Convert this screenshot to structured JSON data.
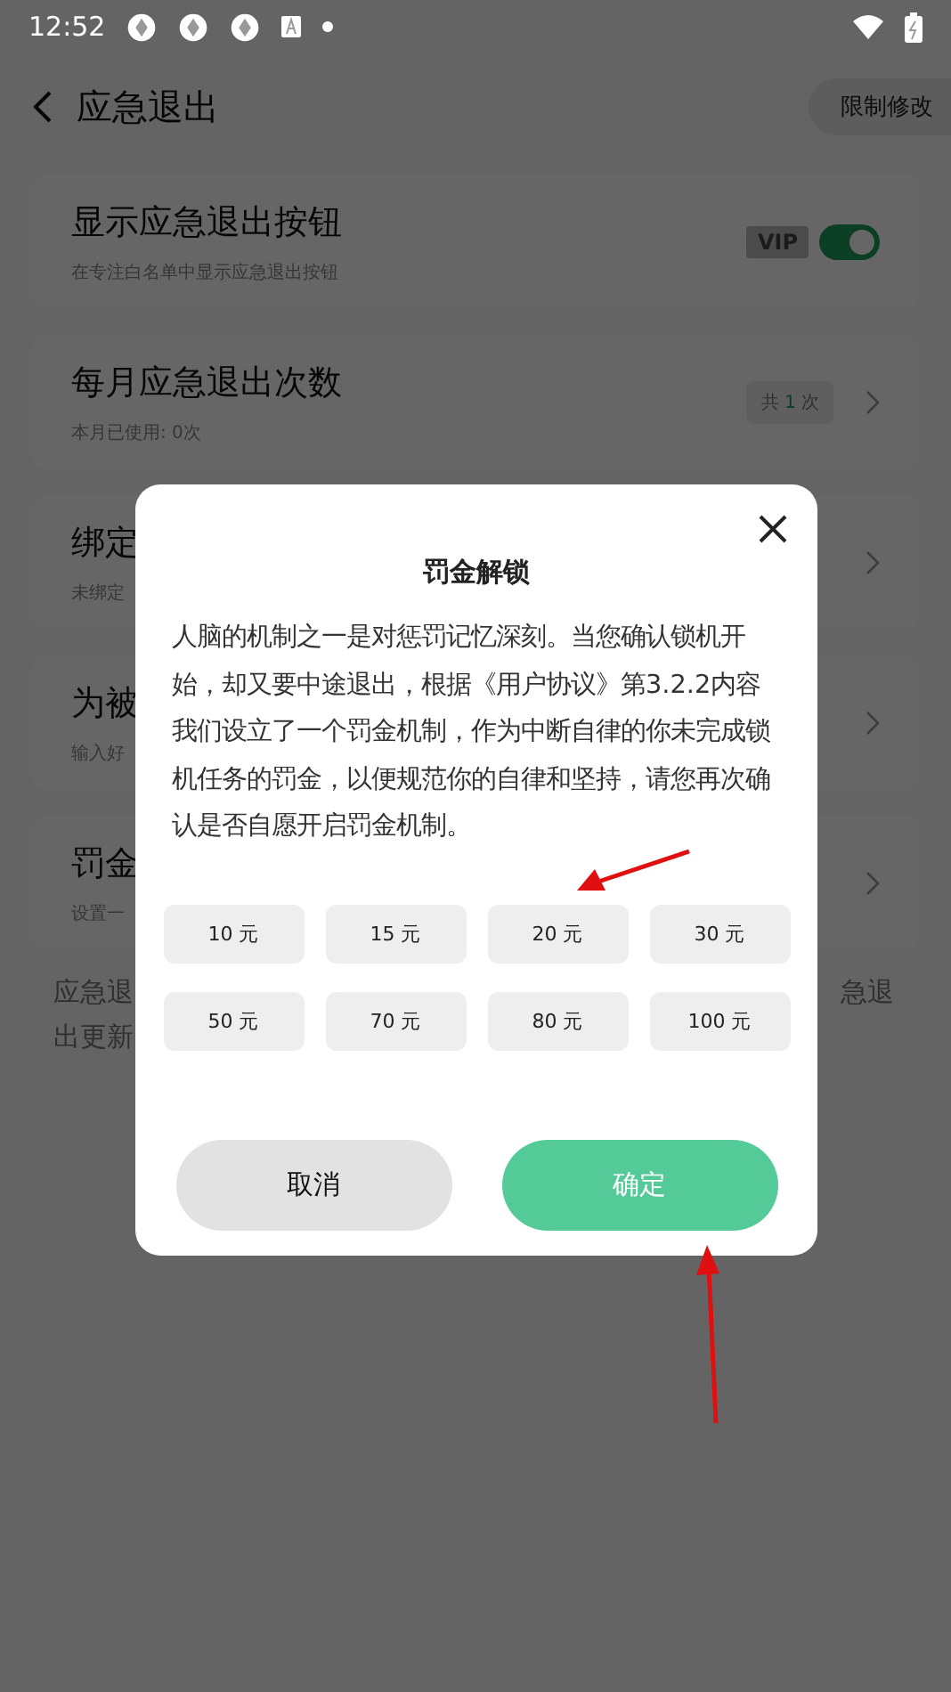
{
  "status_bar": {
    "time": "12:52"
  },
  "header": {
    "title": "应急退出",
    "action": "限制修改"
  },
  "settings": [
    {
      "kind": "toggle",
      "title": "显示应急退出按钮",
      "subtitle": "在专注白名单中显示应急退出按钮",
      "badge": "VIP",
      "on": true
    },
    {
      "kind": "count",
      "title": "每月应急退出次数",
      "subtitle": "本月已使用: 0次",
      "count_prefix": "共",
      "count": "1",
      "count_suffix": "次"
    },
    {
      "kind": "link",
      "title": "绑定",
      "subtitle": "未绑定"
    },
    {
      "kind": "link",
      "title": "为被",
      "subtitle": "输入好"
    },
    {
      "kind": "link",
      "title": "罚金",
      "subtitle": "设置一"
    }
  ],
  "footer": {
    "left_lines": [
      "应急退",
      "出更新"
    ],
    "right_fragment": "急退"
  },
  "dialog": {
    "title": "罚金解锁",
    "body": "人脑的机制之一是对惩罚记忆深刻。当您确认锁机开始，却又要中途退出，根据《用户协议》第3.2.2内容我们设立了一个罚金机制，作为中断自律的你未完成锁机任务的罚金，以便规范你的自律和坚持，请您再次确认是否自愿开启罚金机制。",
    "amounts": [
      {
        "label": "10 元",
        "selected": false
      },
      {
        "label": "15 元",
        "selected": false
      },
      {
        "label": "20 元",
        "selected": false
      },
      {
        "label": "30 元",
        "selected": false
      },
      {
        "label": "50 元",
        "selected": false
      },
      {
        "label": "70 元",
        "selected": false
      },
      {
        "label": "80 元",
        "selected": false
      },
      {
        "label": "100 元",
        "selected": false
      }
    ],
    "cancel": "取消",
    "confirm": "确定"
  }
}
